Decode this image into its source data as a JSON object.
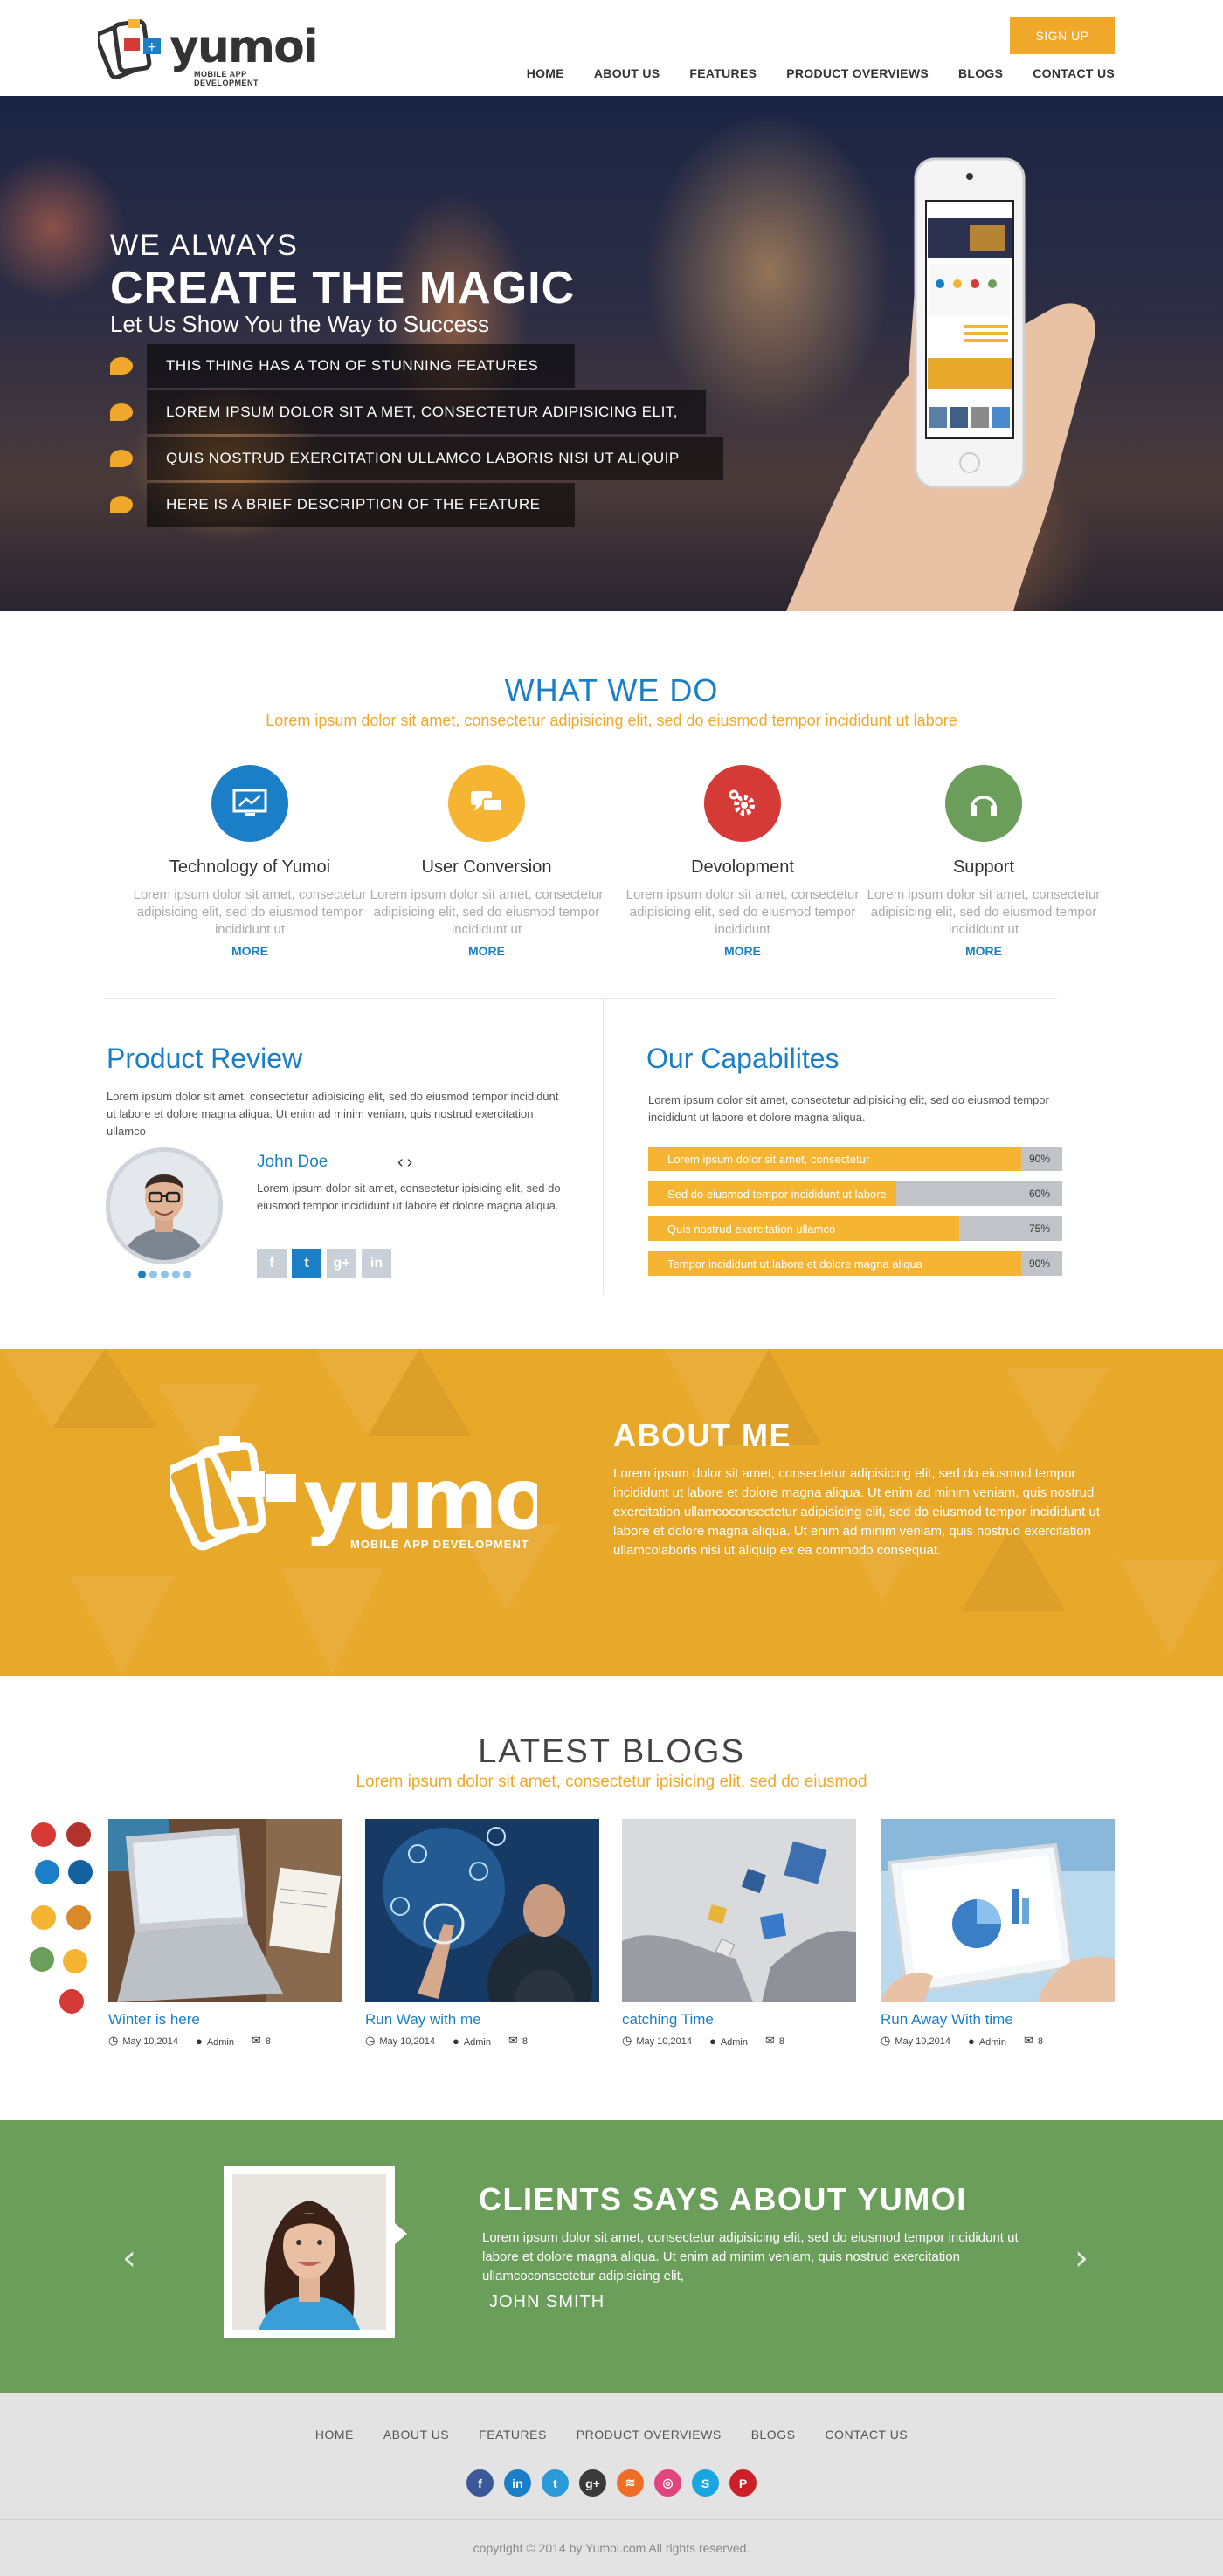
{
  "brand": {
    "name": "yumoi",
    "tagline": "MOBILE APP DEVELOPMENT"
  },
  "header": {
    "signup_label": "SIGN UP",
    "nav": [
      "HOME",
      "ABOUT US",
      "FEATURES",
      "PRODUCT OVERVIEWS",
      "BLOGS",
      "CONTACT US"
    ]
  },
  "hero": {
    "line1": "WE ALWAYS",
    "line2": "CREATE THE MAGIC",
    "line3": "Let Us Show You the Way to Success",
    "features": [
      "THIS THING HAS A TON OF STUNNING FEATURES",
      "LOREM IPSUM DOLOR SIT A MET, CONSECTETUR ADIPISICING ELIT,",
      "QUIS NOSTRUD EXERCITATION ULLAMCO LABORIS NISI UT ALIQUIP",
      "HERE IS A BRIEF DESCRIPTION OF THE FEATURE"
    ]
  },
  "what_we_do": {
    "title": "WHAT WE DO",
    "subtitle": "Lorem ipsum dolor sit amet, consectetur adipisicing elit, sed do eiusmod tempor incididunt ut labore",
    "services": [
      {
        "title": "Technology of Yumoi",
        "text": "Lorem ipsum dolor sit amet, consectetur adipisicing elit, sed do eiusmod tempor incididunt ut",
        "more": "MORE",
        "color": "#1a7fc6",
        "icon": "chart-icon"
      },
      {
        "title": "User Conversion",
        "text": "Lorem ipsum dolor sit amet, consectetur adipisicing elit, sed do eiusmod tempor incididunt ut",
        "more": "MORE",
        "color": "#f6b433",
        "icon": "chat-icon"
      },
      {
        "title": "Devolopment",
        "text": "Lorem ipsum dolor sit amet, consectetur adipisicing elit, sed do eiusmod tempor incididunt",
        "more": "MORE",
        "color": "#d63a36",
        "icon": "gear-icon"
      },
      {
        "title": "Support",
        "text": "Lorem ipsum dolor sit amet, consectetur adipisicing elit, sed do eiusmod tempor incididunt ut",
        "more": "MORE",
        "color": "#6b9e5a",
        "icon": "headphones-icon"
      }
    ]
  },
  "review": {
    "title": "Product Review",
    "intro": "Lorem ipsum dolor sit amet, consectetur adipisicing elit, sed do eiusmod tempor incididunt ut labore et dolore magna aliqua. Ut enim ad minim veniam, quis nostrud exercitation ullamco",
    "name": "John Doe",
    "quote": "Lorem ipsum dolor sit amet, consectetur ipisicing elit, sed do eiusmod tempor incididunt ut labore et dolore magna aliqua.",
    "social": [
      "f",
      "t",
      "g+",
      "in"
    ]
  },
  "capabilities": {
    "title": "Our Capabilites",
    "intro": "Lorem ipsum dolor sit amet, consectetur adipisicing elit, sed do eiusmod tempor incididunt ut labore et dolore magna aliqua.",
    "bars": [
      {
        "label": "Lorem ipsum dolor sit amet, consectetur",
        "value": 0.9,
        "pct": "90%"
      },
      {
        "label": "Sed do eiusmod tempor incididunt ut labore",
        "value": 0.6,
        "pct": "60%"
      },
      {
        "label": "Quis nostrud exercitation ullamco",
        "value": 0.75,
        "pct": "75%"
      },
      {
        "label": "Tempor incididunt ut labore et dolore magna aliqua",
        "value": 0.9,
        "pct": "90%"
      }
    ]
  },
  "about": {
    "title": "ABOUT ME",
    "text": "Lorem ipsum dolor sit amet, consectetur adipisicing elit, sed do eiusmod tempor incididunt ut labore et dolore magna aliqua. Ut enim ad minim veniam, quis nostrud exercitation ullamcoconsectetur adipisicing elit, sed do eiusmod tempor incididunt ut labore et dolore magna aliqua. Ut enim ad minim veniam, quis nostrud exercitation ullamcolaboris nisi ut aliquip ex ea commodo consequat."
  },
  "blogs": {
    "title": "LATEST BLOGS",
    "subtitle": "Lorem ipsum dolor sit amet, consectetur ipisicing elit, sed do eiusmod",
    "posts": [
      {
        "title": "Winter is here",
        "date": "May 10,2014",
        "author": "Admin",
        "comments": "8"
      },
      {
        "title": "Run Way with me",
        "date": "May 10,2014",
        "author": "Admin",
        "comments": "8"
      },
      {
        "title": "catching Time",
        "date": "May 10,2014",
        "author": "Admin",
        "comments": "8"
      },
      {
        "title": "Run Away With time",
        "date": "May 10,2014",
        "author": "Admin",
        "comments": "8"
      }
    ]
  },
  "testimonial": {
    "title": "CLIENTS SAYS ABOUT YUMOI",
    "text": "Lorem ipsum dolor sit amet, consectetur adipisicing elit, sed do eiusmod tempor incididunt ut labore et dolore magna aliqua. Ut enim ad minim veniam, quis nostrud exercitation ullamcoconsectetur adipisicing elit,",
    "name": "JOHN SMITH",
    "prev": "‹",
    "next": "›"
  },
  "footer": {
    "nav": [
      "HOME",
      "ABOUT US",
      "FEATURES",
      "PRODUCT OVERVIEWS",
      "BLOGS",
      "CONTACT US"
    ],
    "social": [
      {
        "icon": "facebook-icon",
        "glyph": "f",
        "color": "#3b5998"
      },
      {
        "icon": "linkedin-icon",
        "glyph": "in",
        "color": "#1a7fc6"
      },
      {
        "icon": "twitter-icon",
        "glyph": "t",
        "color": "#2a9ad8"
      },
      {
        "icon": "googleplus-icon",
        "glyph": "g+",
        "color": "#3a3a3a"
      },
      {
        "icon": "rss-icon",
        "glyph": "≋",
        "color": "#f06d25"
      },
      {
        "icon": "dribbble-icon",
        "glyph": "◎",
        "color": "#e0457b"
      },
      {
        "icon": "skype-icon",
        "glyph": "S",
        "color": "#1aa6e0"
      },
      {
        "icon": "pinterest-icon",
        "glyph": "P",
        "color": "#cb2027"
      }
    ],
    "copyright": "copyright © 2014 by Yumoi.com All rights reserved."
  }
}
